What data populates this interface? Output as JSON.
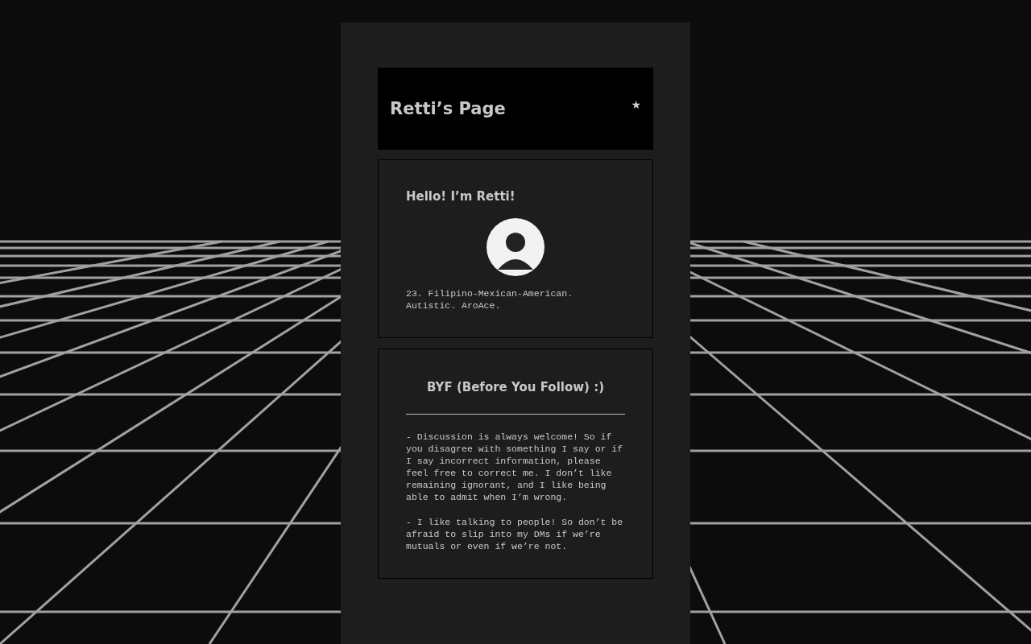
{
  "header": {
    "title": "Retti’s Page",
    "star": "★"
  },
  "intro": {
    "heading": "Hello! I’m Retti!",
    "bio": "23. Filipino-Mexican-American. Autistic. AroAce."
  },
  "byf": {
    "heading": "BYF (Before You Follow) :)",
    "paragraphs": [
      "- Discussion is always welcome! So if you disagree with something I say or if I say incorrect information, please feel free to correct me. I don’t like remaining ignorant, and I like being able to admit when I’m wrong.",
      "- I like talking to people! So don’t be afraid to slip into my DMs if we’re mutuals or even if we’re not."
    ]
  }
}
